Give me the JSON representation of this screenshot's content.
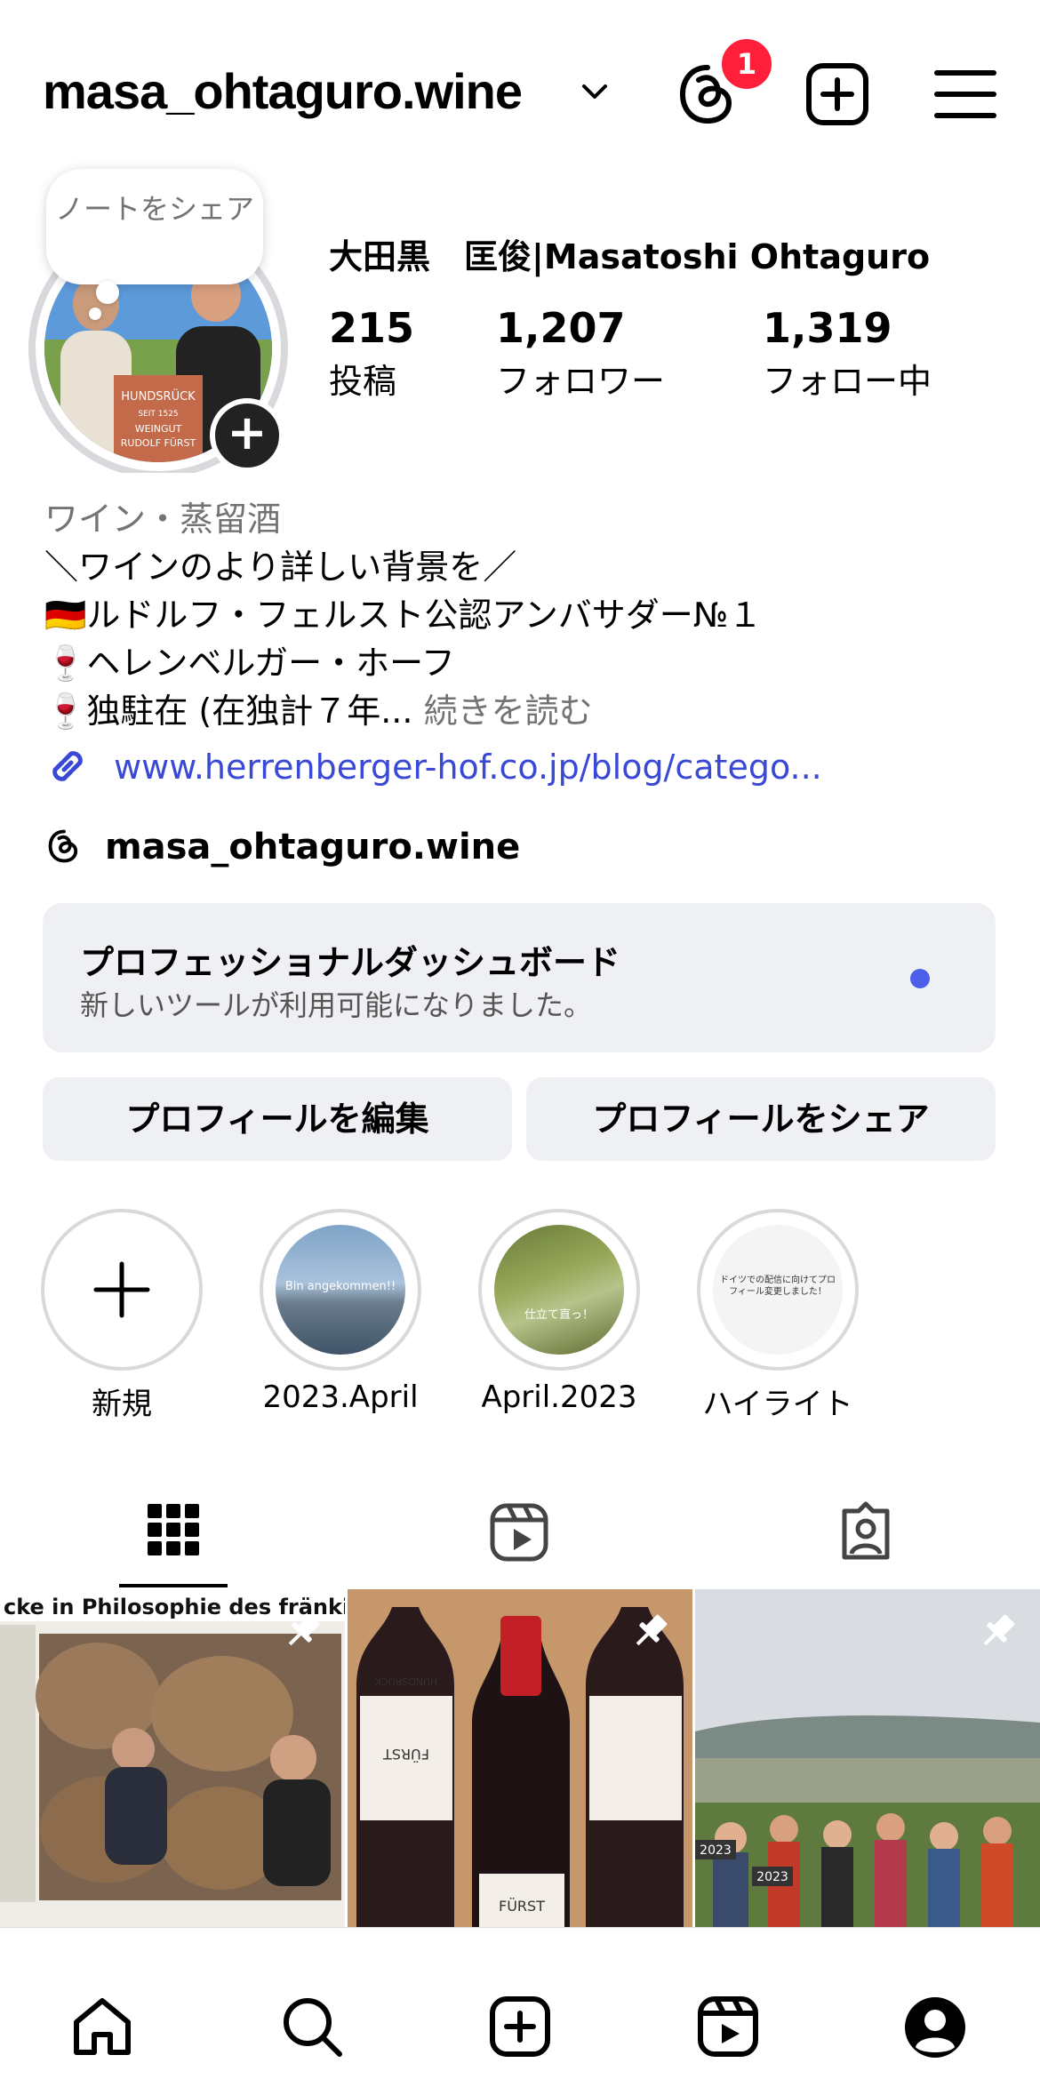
{
  "header": {
    "username": "masa_ohtaguro.wine",
    "threads_badge_count": "1",
    "icons": [
      "threads-icon",
      "create-icon",
      "menu-icon"
    ]
  },
  "profile": {
    "note": "ノートをシェア",
    "full_name": "大田黒　匡俊|Masatoshi Ohtaguro",
    "stats": [
      {
        "value": "215",
        "label": "投稿"
      },
      {
        "value": "1,207",
        "label": "フォロワー"
      },
      {
        "value": "1,319",
        "label": "フォロー中"
      }
    ],
    "category": "ワイン・蒸留酒",
    "bio_lines": [
      "＼ワインのより詳しい背景を／",
      "🇩🇪ルドルフ・フェルスト公認アンバサダー№１",
      "🍷ヘレンベルガー・ホーフ",
      "🍷独駐在 (在独計７年..."
    ],
    "more_label": "続きを読む",
    "link": "www.herrenberger-hof.co.jp/blog/catego...",
    "threads_handle": "masa_ohtaguro.wine"
  },
  "dashboard": {
    "title": "プロフェッショナルダッシュボード",
    "subtitle": "新しいツールが利用可能になりました。"
  },
  "buttons": {
    "edit": "プロフィールを編集",
    "share": "プロフィールをシェア"
  },
  "highlights": [
    {
      "label": "新規"
    },
    {
      "label": "2023.April",
      "overlay": "Bin angekommen!!"
    },
    {
      "label": "April.2023",
      "overlay": "仕立て直っ！"
    },
    {
      "label": "ハイライト",
      "overlay": "ドイツでの配信に向けてプロフィール変更しました！"
    }
  ],
  "grid_posts": [
    {
      "headline": "cke in Philosophie des fränkischen Wei"
    },
    {
      "label_top": "HUNDSRÜCK",
      "brand": "FÜRST"
    },
    {
      "label_1": "2023",
      "label_2": "2023"
    }
  ],
  "avatar_sign": {
    "line1": "HUNDSRÜCK",
    "line2": "SEIT 1525",
    "line3": "WEINGUT",
    "line4": "RUDOLF FÜRST"
  },
  "colors": {
    "link": "#3949d6",
    "badge": "#ff1f3b",
    "dashboard_dot": "#4c5fe8",
    "button_bg": "#eff0f3"
  }
}
